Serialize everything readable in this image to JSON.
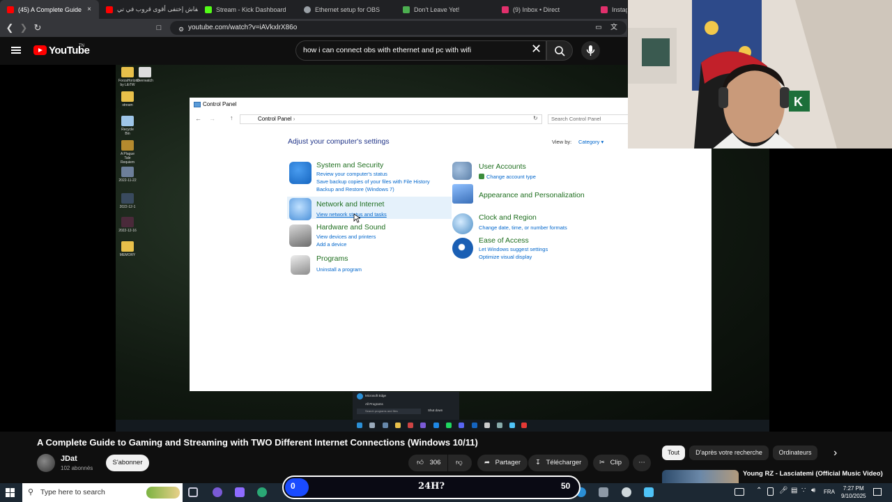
{
  "browser": {
    "tabs": [
      {
        "label": "(45) A Complete Guide",
        "color": "#ff0000"
      },
      {
        "label": "كيفاش إختفى أقوى قروب في تي",
        "color": "#ff0000"
      },
      {
        "label": "Stream - Kick Dashboard",
        "color": "#53fc18"
      },
      {
        "label": "Ethernet setup for OBS",
        "color": "#9aa0a6"
      },
      {
        "label": "Don't Leave Yet!",
        "color": "#4caf50"
      },
      {
        "label": "(9) Inbox • Direct",
        "color": "#e1306c"
      },
      {
        "label": "Instag",
        "color": "#e1306c"
      }
    ],
    "close_icon": "×",
    "url": "youtube.com/watch?v=iAVkxlrX86o"
  },
  "youtube": {
    "logo_text": "YouTube",
    "logo_tn": "TN",
    "search_query": "how i can connect obs with ethernet and pc with wifi",
    "clear_icon": "✕"
  },
  "control_panel": {
    "title": "Control Panel",
    "breadcrumb": "Control Panel",
    "search_placeholder": "Search Control Panel",
    "heading": "Adjust your computer's settings",
    "view_by_label": "View by:",
    "view_by_value": "Category",
    "categories": [
      {
        "title": "System and Security",
        "links": [
          "Review your computer's status",
          "Save backup copies of your files with File History",
          "Backup and Restore (Windows 7)"
        ],
        "icon_color": "#1565c0"
      },
      {
        "title": "Network and Internet",
        "links": [
          "View network status and tasks"
        ],
        "icon_color": "#4a90d9"
      },
      {
        "title": "Hardware and Sound",
        "links": [
          "View devices and printers",
          "Add a device"
        ],
        "icon_color": "#7d7d7d"
      },
      {
        "title": "Programs",
        "links": [
          "Uninstall a program"
        ],
        "icon_color": "#8d8d8d"
      },
      {
        "title": "User Accounts",
        "links": [
          "Change account type"
        ],
        "icon_color": "#5b7fa8"
      },
      {
        "title": "Appearance and Personalization",
        "links": [],
        "icon_color": "#3a6fb8"
      },
      {
        "title": "Clock and Region",
        "links": [
          "Change date, time, or number formats"
        ],
        "icon_color": "#4a8cc4"
      },
      {
        "title": "Ease of Access",
        "links": [
          "Let Windows suggest settings",
          "Optimize visual display"
        ],
        "icon_color": "#1a5fb4"
      }
    ]
  },
  "video_overlay": {
    "start_menu_item": "Microsoft Edge",
    "start_menu_all": "All Programs",
    "start_menu_search": "Search programs and files",
    "shutdown": "Shut down"
  },
  "desktop_icons": [
    "ForzaHorizon by LibTW",
    "Overwatch",
    "stream",
    "Recycle Bin",
    "A Plague Tale Requiem",
    "2022-11-22",
    "2022-12-1",
    "2022-12-16",
    "MEMORY"
  ],
  "video": {
    "title": "A Complete Guide to Gaming and Streaming with TWO Different Internet Connections (Windows 10/11)",
    "channel": "JDat",
    "subscribers": "102 abonnés",
    "subscribe_label": "S'abonner",
    "likes": "306",
    "share_label": "Partager",
    "download_label": "Télécharger",
    "clip_label": "Clip",
    "more_icon": "⋯"
  },
  "recommendations": {
    "chips": [
      "Tout",
      "D'après votre recherche",
      "Ordinateurs"
    ],
    "next_icon": "›",
    "first_title": "Young RZ - Lasciatemi (Official Music Video)"
  },
  "taskbar": {
    "search_placeholder": "Type here to search",
    "banner_left": "0",
    "banner_mid": "24H?",
    "banner_right": "50",
    "language": "FRA",
    "time": "7:27 PM",
    "date": "9/10/2025"
  },
  "colors": {
    "youtube_red": "#ff0000",
    "link_blue": "#0066cc",
    "category_green": "#1e6e1e",
    "heading_blue": "#1e3287"
  }
}
